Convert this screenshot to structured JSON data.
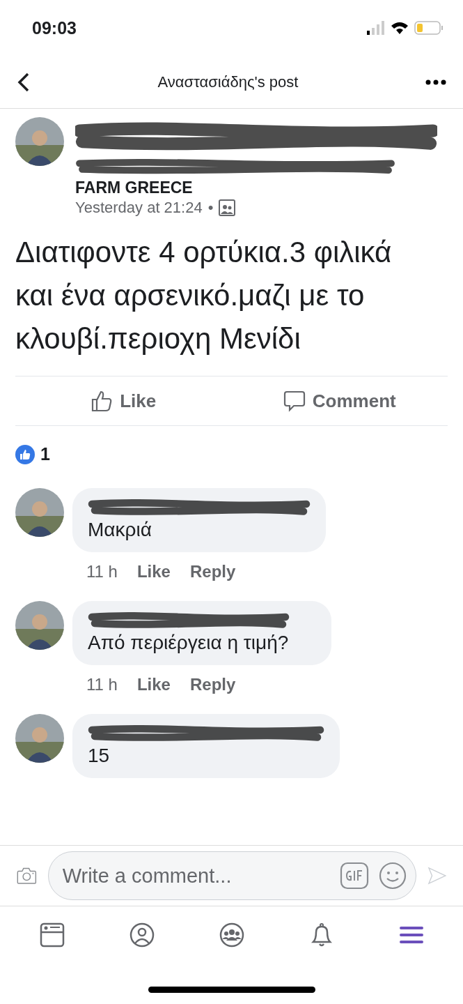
{
  "status_bar": {
    "time": "09:03"
  },
  "header": {
    "title": "Αναστασιάδης's post"
  },
  "post": {
    "author_visible": "FARM GREECE",
    "time": "Yesterday at 21:24",
    "separator": "•",
    "text": "Διατιφοντε 4 ορτύκια.3 φιλικά και ένα αρσενικό.μαζι με το κλουβί.περιοχη Μενίδι"
  },
  "actions": [
    {
      "kind": "like",
      "label": "Like"
    },
    {
      "kind": "comment",
      "label": "Comment"
    }
  ],
  "reactions": {
    "count": "1"
  },
  "comments": [
    {
      "text": "Μακριά",
      "time": "11 h",
      "like": "Like",
      "reply": "Reply"
    },
    {
      "text": "Από περιέργεια η τιμή?",
      "time": "11 h",
      "like": "Like",
      "reply": "Reply"
    },
    {
      "text": "15"
    }
  ],
  "composer": {
    "placeholder": "Write a comment..."
  },
  "nav": [
    {
      "kind": "feed",
      "selected": false
    },
    {
      "kind": "profile",
      "selected": false
    },
    {
      "kind": "groups",
      "selected": false
    },
    {
      "kind": "bell",
      "selected": false
    },
    {
      "kind": "menu",
      "selected": true
    }
  ]
}
